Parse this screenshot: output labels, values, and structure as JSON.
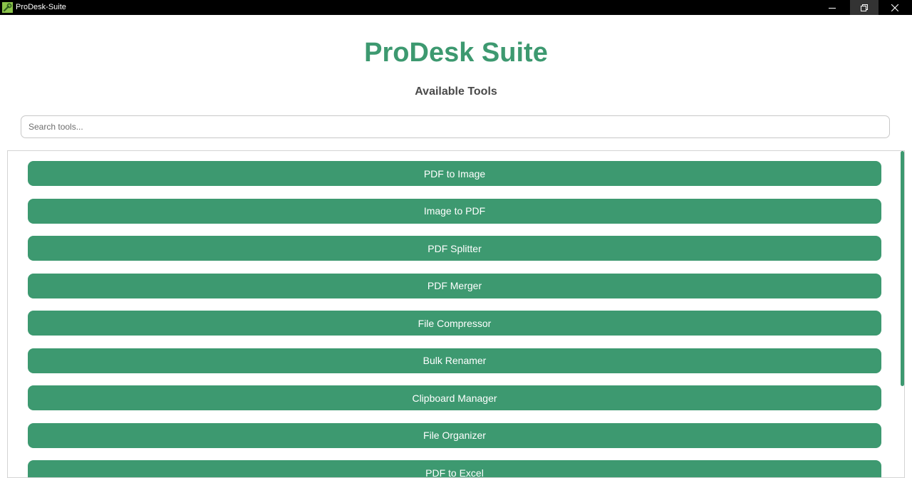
{
  "window": {
    "title": "ProDesk-Suite",
    "app_icon": "wrench-icon",
    "controls": [
      "minimize-icon",
      "restore-icon",
      "close-icon"
    ]
  },
  "header": {
    "title": "ProDesk Suite",
    "subtitle": "Available Tools"
  },
  "search": {
    "placeholder": "Search tools...",
    "value": ""
  },
  "tools": [
    {
      "label": "PDF to Image"
    },
    {
      "label": "Image to PDF"
    },
    {
      "label": "PDF Splitter"
    },
    {
      "label": "PDF Merger"
    },
    {
      "label": "File Compressor"
    },
    {
      "label": "Bulk Renamer"
    },
    {
      "label": "Clipboard Manager"
    },
    {
      "label": "File Organizer"
    },
    {
      "label": "PDF to Excel"
    }
  ],
  "colors": {
    "accent": "#3d9970",
    "button_text": "#ffffff",
    "titlebar": "#000000"
  }
}
